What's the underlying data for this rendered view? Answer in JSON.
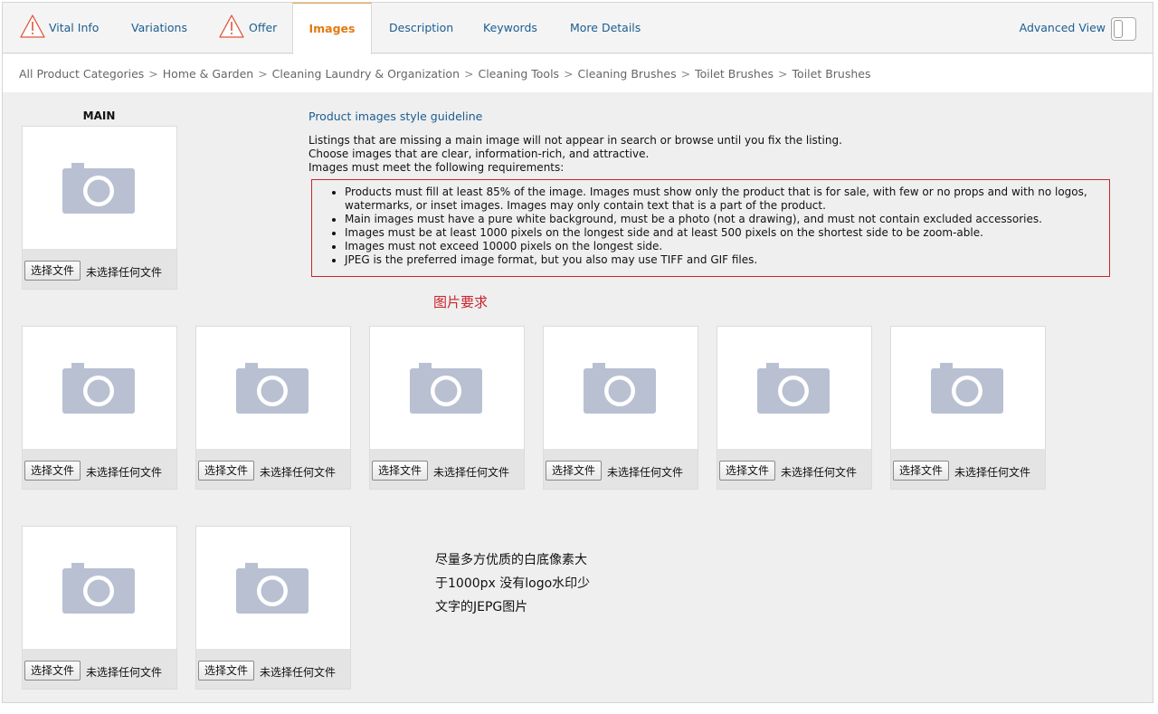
{
  "tabs": [
    {
      "label": "Vital Info",
      "warning": true
    },
    {
      "label": "Variations",
      "warning": false
    },
    {
      "label": "Offer",
      "warning": true
    },
    {
      "label": "Images",
      "active": true
    },
    {
      "label": "Description"
    },
    {
      "label": "Keywords"
    },
    {
      "label": "More Details"
    }
  ],
  "advanced_view": "Advanced View",
  "breadcrumb": [
    "All Product Categories",
    "Home & Garden",
    "Cleaning Laundry & Organization",
    "Cleaning Tools",
    "Cleaning Brushes",
    "Toilet Brushes",
    "Toilet Brushes"
  ],
  "breadcrumb_sep": ">",
  "main_label": "MAIN",
  "file_button": "选择文件",
  "file_status": "未选择任何文件",
  "guideline": {
    "link": "Product images style guideline",
    "lines": [
      "Listings that are missing a main image will not appear in search or browse until you fix the listing.",
      "Choose images that are clear, information-rich, and attractive.",
      "Images must meet the following requirements:"
    ],
    "requirements": [
      "Products must fill at least 85% of the image. Images must show only the product that is for sale, with few or no props and with no logos, watermarks, or inset images. Images may only contain text that is a part of the product.",
      "Main images must have a pure white background, must be a photo (not a drawing), and must not contain excluded accessories.",
      "Images must be at least 1000 pixels on the longest side and at least 500 pixels on the shortest side to be zoom-able.",
      "Images must not exceed 10000 pixels on the longest side.",
      "JPEG is the preferred image format, but you also may use TIFF and GIF files."
    ]
  },
  "annotations": {
    "image_requirements": "图片要求",
    "tip_lines": [
      "尽量多方优质的白底像素大",
      "于1000px 没有logo水印少",
      "文字的JEPG图片"
    ]
  },
  "colors": {
    "link": "#1c5d90",
    "active_tab": "#e47911",
    "warning": "#e0553a",
    "annotation_red": "#c9242b",
    "camera": "#b8c0d2"
  },
  "icons": {
    "warning": "warning-triangle-icon",
    "slot_placeholder": "camera-icon"
  }
}
